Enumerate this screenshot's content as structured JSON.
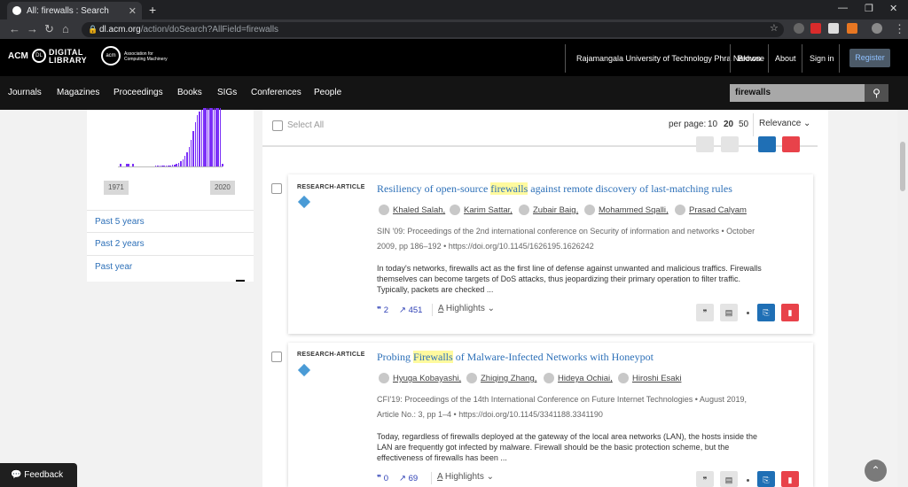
{
  "browser": {
    "tab_title": "All: firewalls : Search",
    "url_host": "dl.acm.org",
    "url_path": "/action/doSearch?AllField=firewalls"
  },
  "header": {
    "logo_acm": "ACM",
    "logo_dl": "DIGITAL LIBRARY",
    "assoc": "Association for Computing Machinery",
    "institution": "Rajamangala University of Technology Phra Nakhon",
    "browse": "Browse",
    "about": "About",
    "signin": "Sign in",
    "register": "Register"
  },
  "nav": {
    "items": [
      "Journals",
      "Magazines",
      "Proceedings",
      "Books",
      "SIGs",
      "Conferences",
      "People"
    ],
    "search_value": "firewalls"
  },
  "sidebar": {
    "year_start": "1971",
    "year_end": "2020",
    "links": [
      "Past 5 years",
      "Past 2 years",
      "Past year"
    ]
  },
  "toolbar": {
    "select_all": "Select All",
    "per_page_label": "per page:",
    "per_page_options": [
      "10",
      "20",
      "50"
    ],
    "per_page_selected": "20",
    "sort": "Relevance"
  },
  "results": [
    {
      "type": "RESEARCH-ARTICLE",
      "title_pre": "Resiliency of open-source ",
      "title_hl": "firewalls",
      "title_post": " against remote discovery of last-matching rules",
      "authors": [
        "Khaled Salah,",
        "Karim Sattar,",
        "Zubair Baig,",
        "Mohammed Sqalli,",
        "Prasad Calyam"
      ],
      "meta_line1": "SIN '09: Proceedings of the 2nd international conference on Security of information and networks • October",
      "meta_line2": "2009, pp 186–192 • https://doi.org/10.1145/1626195.1626242",
      "abstract_lines": [
        "In today's networks, firewalls act as the first line of defense against unwanted and malicious traffics. Firewalls",
        "themselves can become targets of DoS attacks, thus jeopardizing their primary operation to filter traffic.",
        "Typically, packets are checked ..."
      ],
      "citations": "2",
      "downloads": "451",
      "highlights": "Highlights"
    },
    {
      "type": "RESEARCH-ARTICLE",
      "title_pre": "Probing ",
      "title_hl": "Firewalls",
      "title_post": " of Malware-Infected Networks with Honeypot",
      "authors": [
        "Hyuga Kobayashi,",
        "Zhiqing Zhang,",
        "Hideya Ochiai,",
        "Hiroshi Esaki"
      ],
      "meta_line1": "CFI'19: Proceedings of the 14th International Conference on Future Internet Technologies • August 2019,",
      "meta_line2": "Article No.: 3, pp 1–4 • https://doi.org/10.1145/3341188.3341190",
      "abstract_lines": [
        "Today, regardless of firewalls deployed at the gateway of the local area networks (LAN), the hosts inside the",
        "LAN are frequently got infected by malware. Firewall should be the basic protection scheme, but the",
        "effectiveness of firewalls has been ..."
      ],
      "citations": "0",
      "downloads": "69",
      "highlights": "Highlights"
    }
  ],
  "feedback": "Feedback",
  "colors": {
    "accent": "#2d70b8",
    "histogram": "#7b2ff7",
    "pdf": "#e8424a"
  }
}
